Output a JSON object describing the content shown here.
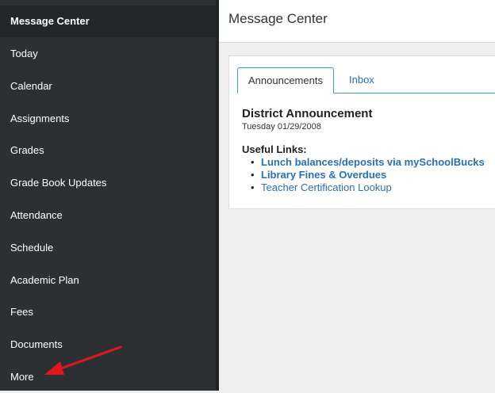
{
  "sidebar": {
    "items": [
      {
        "label": "Message Center",
        "active": true
      },
      {
        "label": "Today"
      },
      {
        "label": "Calendar"
      },
      {
        "label": "Assignments"
      },
      {
        "label": "Grades"
      },
      {
        "label": "Grade Book Updates"
      },
      {
        "label": "Attendance"
      },
      {
        "label": "Schedule"
      },
      {
        "label": "Academic Plan"
      },
      {
        "label": "Fees"
      },
      {
        "label": "Documents"
      },
      {
        "label": "More"
      }
    ]
  },
  "header": {
    "title": "Message Center"
  },
  "tabs": [
    {
      "label": "Announcements",
      "active": true
    },
    {
      "label": "Inbox"
    }
  ],
  "announcement": {
    "title": "District Announcement",
    "date": "Tuesday 01/29/2008",
    "links_heading": "Useful Links:",
    "links": [
      {
        "label": "Lunch balances/deposits via mySchoolBucks"
      },
      {
        "label": "Library Fines & Overdues"
      },
      {
        "label": "Teacher Certification Lookup"
      }
    ]
  },
  "colors": {
    "sidebar": "#2c3032",
    "link": "#2a6fb0",
    "arrow": "#e3161b"
  }
}
